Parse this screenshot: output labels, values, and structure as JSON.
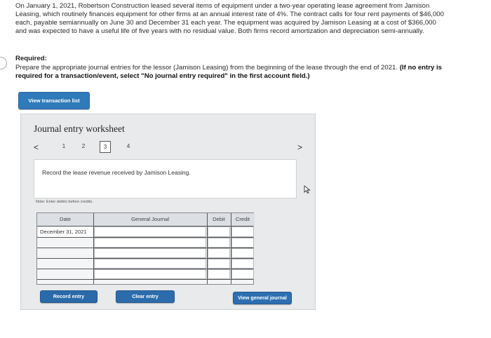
{
  "problem": {
    "text": "On January 1, 2021, Robertson Construction leased several items of equipment under a two-year operating lease agreement from Jamison Leasing, which routinely finances equipment for other firms at an annual interest rate of 4%. The contract calls for four rent payments of $46,000 each, payable semiannually on June 30 and December 31 each year. The equipment was acquired by Jamison Leasing at a cost of $366,000 and was expected to have a useful life of five years with no residual value. Both firms record amortization and depreciation semi-annually."
  },
  "required": {
    "title": "Required:",
    "body": "Prepare the appropriate journal entries for the lessor (Jamison Leasing) from the beginning of the lease through the end of 2021.",
    "note": "(If no entry is required for a transaction/event, select \"No journal entry required\" in the first account field.)"
  },
  "buttons": {
    "view_transaction_list": "View transaction list",
    "record_entry": "Record entry",
    "clear_entry": "Clear entry",
    "view_general_journal": "View general journal"
  },
  "worksheet": {
    "title": "Journal entry worksheet",
    "steps": [
      "1",
      "2",
      "3",
      "4"
    ],
    "active_step": "3",
    "prev_icon": "<",
    "next_icon": ">",
    "description": "Record the lease revenue received by Jamison Leasing.",
    "note": "Note: Enter debits before credits.",
    "table": {
      "headers": {
        "date": "Date",
        "general_journal": "General Journal",
        "debit": "Debit",
        "credit": "Credit"
      },
      "date_value": "December 31, 2021"
    }
  }
}
